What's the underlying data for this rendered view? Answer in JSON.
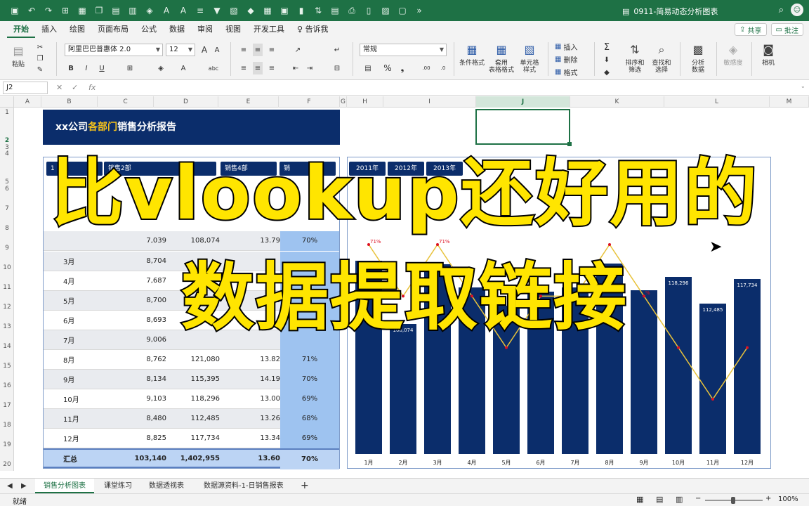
{
  "app": {
    "doc_title": "0911-简易动态分析图表"
  },
  "ribbon_tabs": [
    "开始",
    "插入",
    "绘图",
    "页面布局",
    "公式",
    "数据",
    "审阅",
    "视图",
    "开发工具"
  ],
  "tell_me": "告诉我",
  "share_label": "共享",
  "comment_label": "批注",
  "ribbon": {
    "paste": "粘贴",
    "font_name": "阿里巴巴普惠体 2.0",
    "font_size": "12",
    "number_format": "常规",
    "conditional_format": "条件格式",
    "table_format": "套用\n表格格式",
    "cell_style": "单元格\n样式",
    "insert": "插入",
    "delete": "删除",
    "format": "格式",
    "sort_filter": "排序和\n筛选",
    "find_select": "查找和\n选择",
    "analyze": "分析\n数据",
    "sensitivity": "敏感度",
    "camera": "相机"
  },
  "formula_bar": {
    "name_box": "J2",
    "fx": "fx"
  },
  "columns": [
    "A",
    "B",
    "C",
    "D",
    "E",
    "F",
    "G",
    "H",
    "I",
    "J",
    "K",
    "L",
    "M"
  ],
  "rows": [
    "1",
    "2",
    "3",
    "4",
    "5",
    "6",
    "7",
    "8",
    "9",
    "10",
    "11",
    "12",
    "13",
    "14",
    "15",
    "16",
    "17",
    "18",
    "19",
    "20"
  ],
  "report": {
    "title_pre": "xx公司",
    "title_hl": "各部门",
    "title_post": "销售分析报告",
    "dept_buttons": [
      "1",
      "销售2部",
      "销售4部",
      "销"
    ],
    "year_buttons": [
      "2011年",
      "2012年",
      "2013年"
    ],
    "table_rows": [
      {
        "month": "",
        "c2": "7,039",
        "c3": "108,074",
        "c4": "13.79",
        "c5": "70%"
      },
      {
        "month": "3月",
        "c2": "8,704",
        "c3": "",
        "c4": "",
        "c5": ""
      },
      {
        "month": "4月",
        "c2": "7,687",
        "c3": "",
        "c4": "",
        "c5": ""
      },
      {
        "month": "5月",
        "c2": "8,700",
        "c3": "",
        "c4": "1",
        "c5": ""
      },
      {
        "month": "6月",
        "c2": "8,693",
        "c3": "",
        "c4": "",
        "c5": ""
      },
      {
        "month": "7月",
        "c2": "9,006",
        "c3": "",
        "c4": "",
        "c5": ""
      },
      {
        "month": "8月",
        "c2": "8,762",
        "c3": "121,080",
        "c4": "13.82",
        "c5": "71%"
      },
      {
        "month": "9月",
        "c2": "8,134",
        "c3": "115,395",
        "c4": "14.19",
        "c5": "70%"
      },
      {
        "month": "10月",
        "c2": "9,103",
        "c3": "118,296",
        "c4": "13.00",
        "c5": "69%"
      },
      {
        "month": "11月",
        "c2": "8,480",
        "c3": "112,485",
        "c4": "13.26",
        "c5": "68%"
      },
      {
        "month": "12月",
        "c2": "8,825",
        "c3": "117,734",
        "c4": "13.34",
        "c5": "69%"
      }
    ],
    "total_row": {
      "month": "汇总",
      "c2": "103,140",
      "c3": "1,402,955",
      "c4": "13.60",
      "c5": "70%"
    }
  },
  "chart_data": {
    "type": "bar",
    "categories": [
      "1月",
      "2月",
      "3月",
      "4月",
      "5月",
      "6月",
      "7月",
      "8月",
      "9月",
      "10月",
      "11月",
      "12月"
    ],
    "visible_value_labels": [
      "121,756",
      "108,074",
      "",
      "",
      "",
      "",
      "",
      "121",
      "",
      "118,296",
      "112,485",
      "117,734"
    ],
    "values": [
      121756,
      108074,
      121000,
      116000,
      112000,
      115000,
      116000,
      121080,
      115395,
      118296,
      112485,
      117734
    ],
    "ylim": [
      80000,
      126000
    ],
    "line_percent_labels": [
      "71%",
      "",
      "71%",
      "",
      "",
      "",
      "",
      "",
      "%",
      "",
      "",
      ""
    ],
    "line_values": [
      71,
      70,
      71,
      70,
      69,
      70,
      70,
      71,
      70,
      69,
      68,
      69
    ],
    "bar_color": "#0b2d6b",
    "line_color": "#e8c23a"
  },
  "overlay": {
    "line1": "比vlookup还好用的",
    "line2": "数据提取链接"
  },
  "sheet_tabs": [
    "销售分析图表",
    "课堂练习",
    "数据透视表",
    "数据源资料-1-日销售报表"
  ],
  "status": {
    "ready": "就绪",
    "zoom": "100%"
  },
  "colors": {
    "excel_green": "#1e7145",
    "navy": "#0b2d6b",
    "gold": "#f5c21b",
    "overlay_yellow": "#ffe500"
  }
}
